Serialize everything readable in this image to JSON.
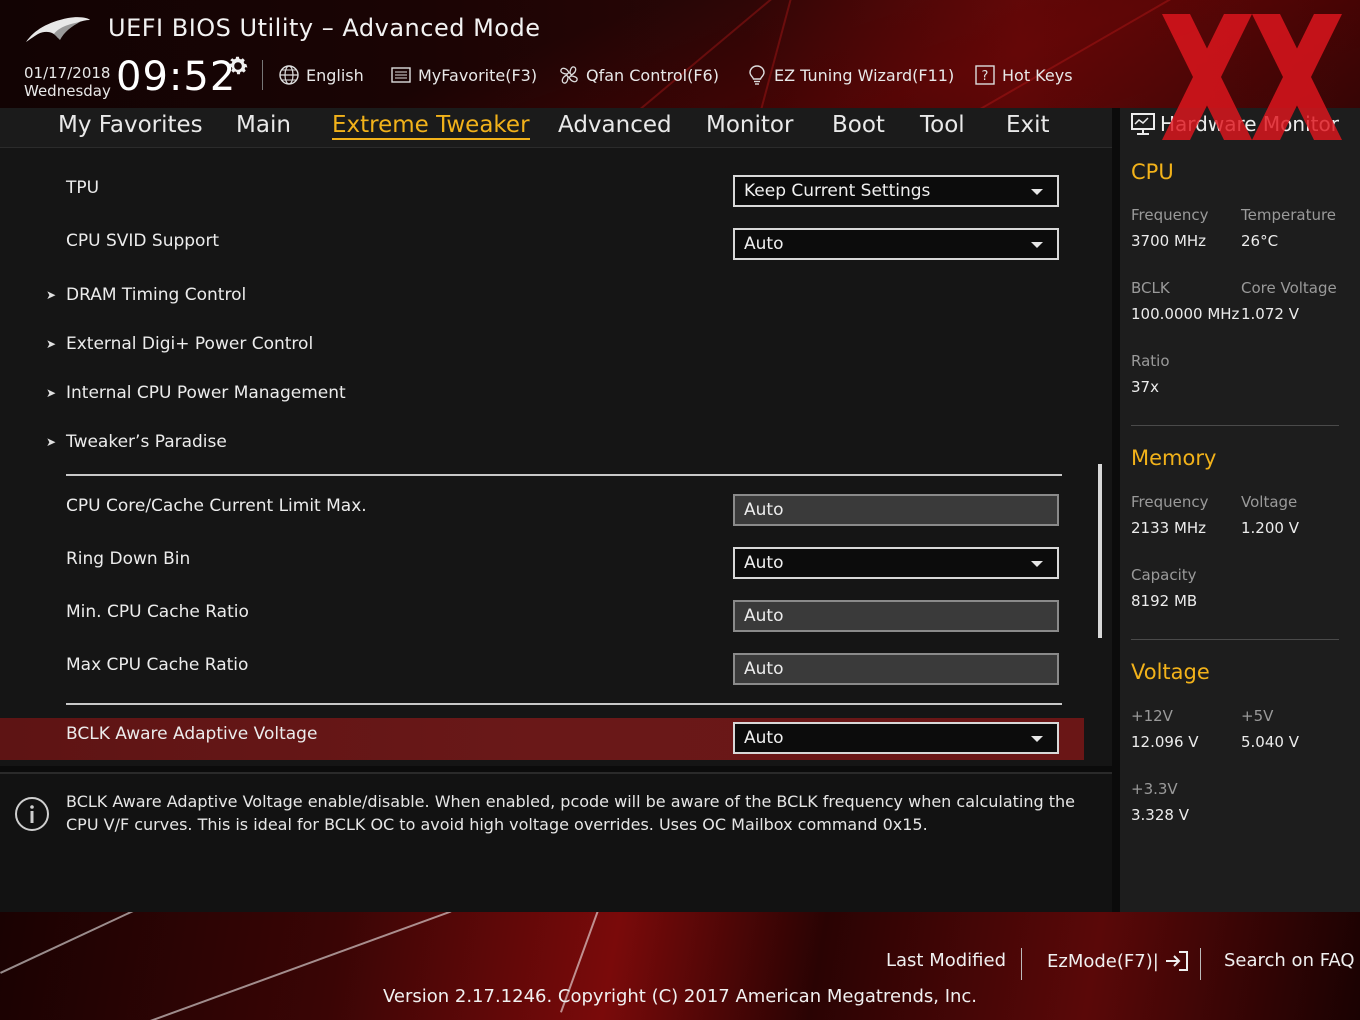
{
  "header": {
    "title": "UEFI BIOS Utility – Advanced Mode",
    "date": "01/17/2018",
    "day": "Wednesday",
    "time": "09:52",
    "language": "English",
    "my_favorite": "MyFavorite(F3)",
    "qfan": "Qfan Control(F6)",
    "ez_tuning": "EZ Tuning Wizard(F11)",
    "hot_keys": "Hot Keys"
  },
  "nav": {
    "tabs": [
      "My Favorites",
      "Main",
      "Extreme Tweaker",
      "Advanced",
      "Monitor",
      "Boot",
      "Tool",
      "Exit"
    ],
    "active": "Extreme Tweaker"
  },
  "settings": {
    "tpu": {
      "label": "TPU",
      "value": "Keep Current Settings"
    },
    "cpu_svid": {
      "label": "CPU SVID Support",
      "value": "Auto"
    },
    "submenus": [
      "DRAM Timing Control",
      "External Digi+ Power Control",
      "Internal CPU Power Management",
      "Tweaker’s Paradise"
    ],
    "current_limit": {
      "label": "CPU Core/Cache Current Limit Max.",
      "value": "Auto"
    },
    "ring_down": {
      "label": "Ring Down Bin",
      "value": "Auto"
    },
    "min_cache": {
      "label": "Min. CPU Cache Ratio",
      "value": "Auto"
    },
    "max_cache": {
      "label": "Max CPU Cache Ratio",
      "value": "Auto"
    },
    "bclk_aware": {
      "label": "BCLK Aware Adaptive Voltage",
      "value": "Auto"
    }
  },
  "info": {
    "text": "BCLK Aware Adaptive Voltage enable/disable. When enabled, pcode will be aware of the BCLK frequency when calculating the CPU V/F curves. This is ideal for BCLK OC to avoid high voltage overrides. Uses OC Mailbox command 0x15."
  },
  "hw_monitor": {
    "title": "Hardware Monitor",
    "cpu": {
      "heading": "CPU",
      "frequency_label": "Frequency",
      "frequency": "3700 MHz",
      "temperature_label": "Temperature",
      "temperature": "26°C",
      "bclk_label": "BCLK",
      "bclk": "100.0000 MHz",
      "core_voltage_label": "Core Voltage",
      "core_voltage": "1.072 V",
      "ratio_label": "Ratio",
      "ratio": "37x"
    },
    "memory": {
      "heading": "Memory",
      "frequency_label": "Frequency",
      "frequency": "2133 MHz",
      "voltage_label": "Voltage",
      "voltage": "1.200 V",
      "capacity_label": "Capacity",
      "capacity": "8192 MB"
    },
    "voltage": {
      "heading": "Voltage",
      "v12_label": "+12V",
      "v12": "12.096 V",
      "v5_label": "+5V",
      "v5": "5.040 V",
      "v33_label": "+3.3V",
      "v33": "3.328 V"
    }
  },
  "footer": {
    "last_modified": "Last Modified",
    "ezmode": "EzMode(F7)|",
    "search_faq": "Search on FAQ",
    "version": "Version 2.17.1246. Copyright (C) 2017 American Megatrends, Inc."
  },
  "colors": {
    "accent": "#f2b21a",
    "highlight_row": "#6a1818",
    "watermark": "#e0161e"
  }
}
